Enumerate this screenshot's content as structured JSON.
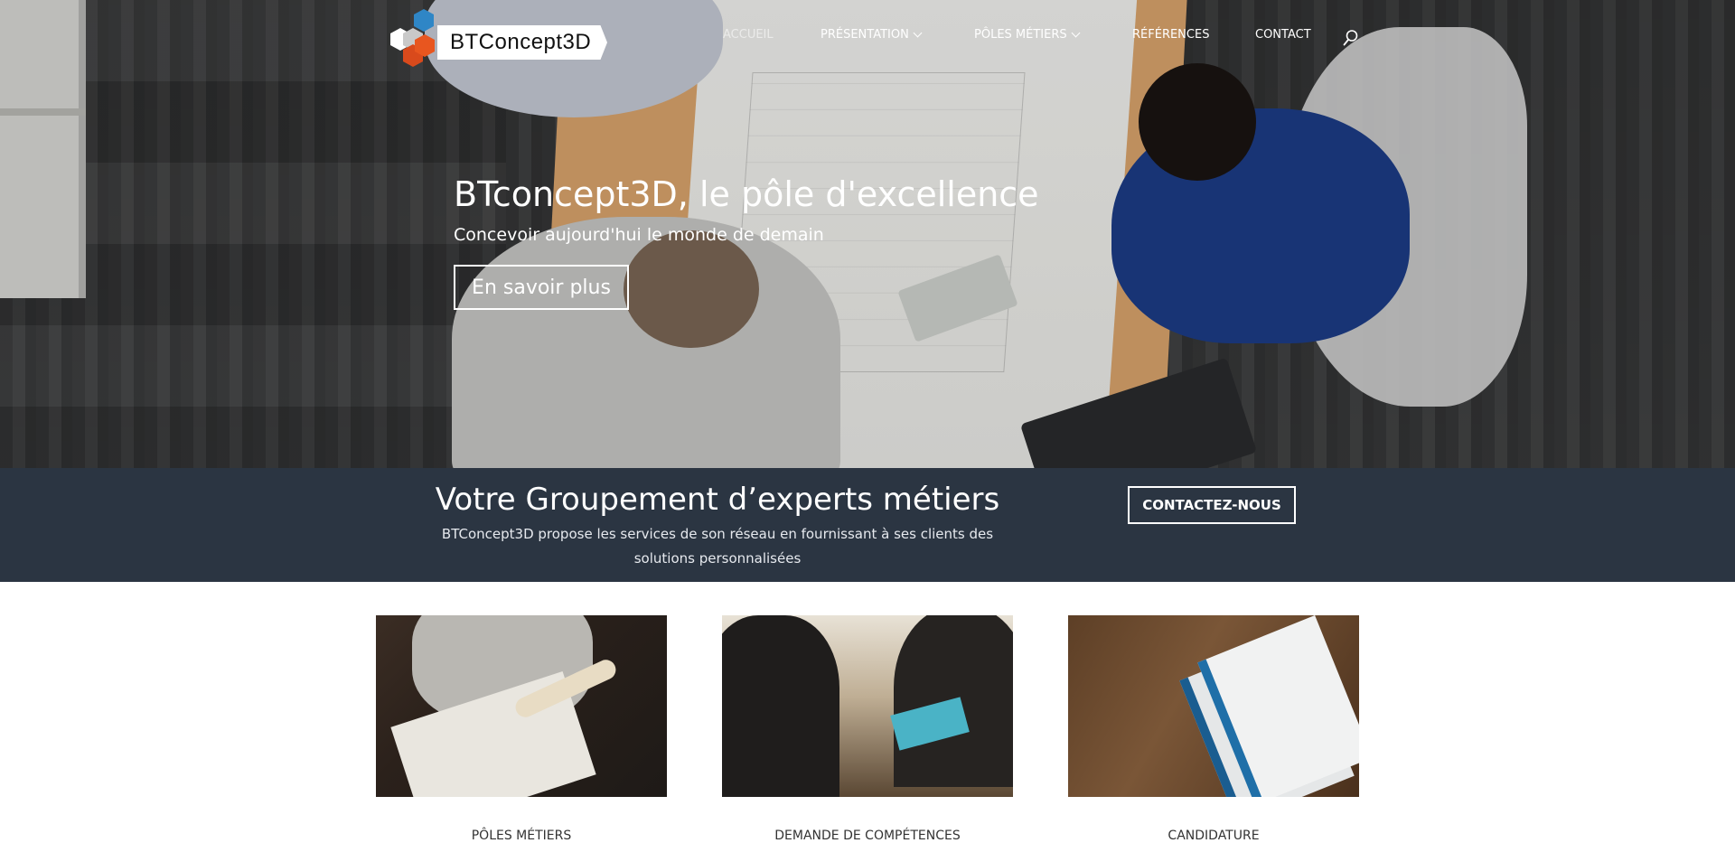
{
  "header": {
    "logo_text": "BTConcept3D",
    "nav": [
      {
        "label": "ACCUEIL",
        "active": true,
        "dropdown": false
      },
      {
        "label": "PRÉSENTATION",
        "active": false,
        "dropdown": true
      },
      {
        "label": "PÔLES MÉTIERS",
        "active": false,
        "dropdown": true
      },
      {
        "label": "RÉFÉRENCES",
        "active": false,
        "dropdown": false
      },
      {
        "label": "CONTACT",
        "active": false,
        "dropdown": false
      }
    ],
    "search_icon": "search-icon"
  },
  "hero": {
    "title": "BTconcept3D, le pôle d'excellence",
    "subtitle": "Concevoir aujourd'hui le monde de demain",
    "button_label": "En savoir plus"
  },
  "cta": {
    "title": "Votre Groupement d’experts métiers",
    "text": "BTConcept3D propose les services de son réseau en fournissant à ses clients des solutions personnalisées",
    "button_label": "CONTACTEZ-NOUS",
    "background_color": "#2b3542"
  },
  "cards": [
    {
      "caption": "PÔLES MÉTIERS"
    },
    {
      "caption": "DEMANDE DE COMPÉTENCES"
    },
    {
      "caption": "CANDIDATURE"
    }
  ],
  "colors": {
    "logo_blue": "#2f86c6",
    "logo_orange": "#e8561f",
    "nav_text": "#ffffff"
  }
}
